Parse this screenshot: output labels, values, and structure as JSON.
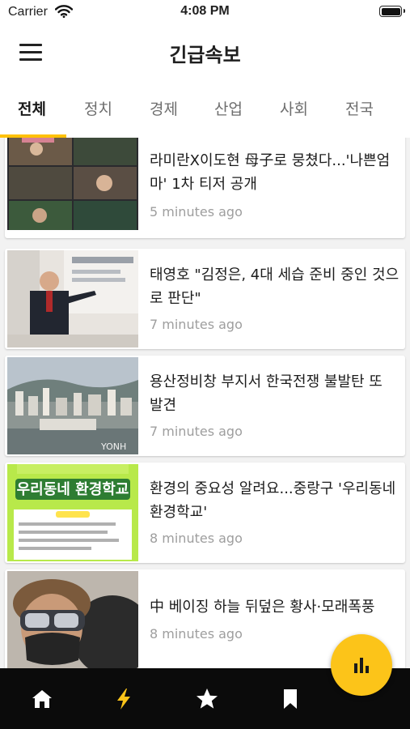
{
  "status_bar": {
    "carrier": "Carrier",
    "time": "4:08 PM"
  },
  "app_bar": {
    "title": "긴급속보"
  },
  "tabs": [
    {
      "label": "전체",
      "active": true
    },
    {
      "label": "정치",
      "active": false
    },
    {
      "label": "경제",
      "active": false
    },
    {
      "label": "산업",
      "active": false
    },
    {
      "label": "사회",
      "active": false
    },
    {
      "label": "전국",
      "active": false
    }
  ],
  "articles": [
    {
      "title": "라미란X이도현 母子로 뭉쳤다...'나쁜엄마' 1차 티저 공개",
      "time": "5 minutes ago",
      "thumb_icon": "drama-stills-photo"
    },
    {
      "title": "태영호 \"김정은, 4대 세습 준비 중인 것으로 판단\"",
      "time": "7 minutes ago",
      "thumb_icon": "speaker-photo"
    },
    {
      "title": "용산정비창 부지서 한국전쟁 불발탄 또 발견",
      "time": "7 minutes ago",
      "thumb_icon": "city-skyline-photo",
      "thumb_watermark": "YONH"
    },
    {
      "title": "환경의 중요성 알려요...중랑구 '우리동네 환경학교'",
      "time": "8 minutes ago",
      "thumb_icon": "poster-photo",
      "thumb_text": "우리동네 환경학교"
    },
    {
      "title": "中 베이징 하늘 뒤덮은 황사·모래폭풍",
      "time": "8 minutes ago",
      "thumb_icon": "goggles-mask-photo"
    }
  ],
  "bottom_nav": [
    {
      "icon": "home-icon",
      "active": false
    },
    {
      "icon": "lightning-icon",
      "active": true
    },
    {
      "icon": "star-icon",
      "active": false
    },
    {
      "icon": "bookmark-icon",
      "active": false
    }
  ],
  "fab": {
    "icon": "bar-chart-icon"
  },
  "colors": {
    "accent": "#FFC107",
    "nav_background": "#0B0B0B",
    "time_text": "#9E9E9E"
  }
}
